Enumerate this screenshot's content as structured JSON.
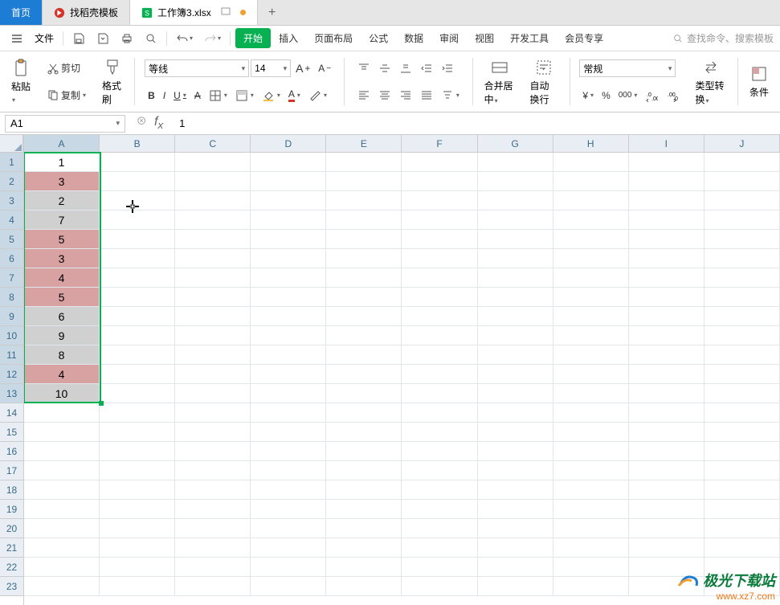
{
  "tabs": {
    "home": "首页",
    "t1": {
      "label": "找稻壳模板"
    },
    "t2": {
      "label": "工作簿3.xlsx"
    },
    "add": "+"
  },
  "menu": {
    "file": "文件",
    "items": [
      "开始",
      "插入",
      "页面布局",
      "公式",
      "数据",
      "审阅",
      "视图",
      "开发工具",
      "会员专享"
    ],
    "search_placeholder": "查找命令、搜索模板"
  },
  "ribbon": {
    "paste": "粘贴",
    "cut": "剪切",
    "copy": "复制",
    "format_painter": "格式刷",
    "font": "等线",
    "font_size": "14",
    "merge": "合并居中",
    "wrap": "自动换行",
    "num_fmt": "常规",
    "type_convert": "类型转换",
    "cond": "条件"
  },
  "namebox": "A1",
  "formula_value": "1",
  "columns": [
    "A",
    "B",
    "C",
    "D",
    "E",
    "F",
    "G",
    "H",
    "I",
    "J"
  ],
  "rows_count": 23,
  "cells": {
    "A": [
      {
        "v": "1",
        "hl": false,
        "active": true
      },
      {
        "v": "3",
        "hl": true
      },
      {
        "v": "2",
        "hl": false
      },
      {
        "v": "7",
        "hl": false
      },
      {
        "v": "5",
        "hl": true
      },
      {
        "v": "3",
        "hl": true
      },
      {
        "v": "4",
        "hl": true
      },
      {
        "v": "5",
        "hl": true
      },
      {
        "v": "6",
        "hl": false
      },
      {
        "v": "9",
        "hl": false
      },
      {
        "v": "8",
        "hl": false
      },
      {
        "v": "4",
        "hl": true
      },
      {
        "v": "10",
        "hl": false
      }
    ]
  },
  "selection": {
    "col": 0,
    "row_start": 0,
    "row_end": 12
  },
  "watermark": {
    "brand": "极光下载站",
    "url": "www.xz7.com"
  }
}
